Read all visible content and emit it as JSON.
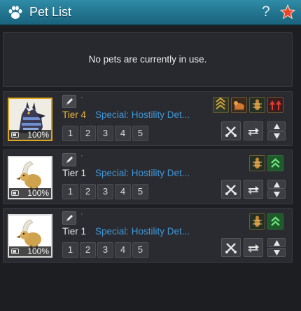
{
  "window": {
    "title": "Pet List",
    "help_label": "?",
    "title_icon": "paw-icon",
    "favorite_icon": "star-icon"
  },
  "notice": {
    "text": "No pets are currently in use."
  },
  "colors": {
    "titlebar": "#22748f",
    "tier_highlight": "#e6b43a",
    "special_link": "#3f97d8",
    "portrait_active_border": "#e0a51e"
  },
  "pets": [
    {
      "tier_label": "Tier",
      "tier_num": "4",
      "special": "Special: Hostility Det...",
      "stamina": "100%",
      "portrait": "armored-wolf",
      "buffs": [
        "tier-up-buff-icon",
        "gather-buff-icon",
        "bug-buff-icon",
        "attack-up-buff-icon"
      ],
      "skill_slots": [
        "1",
        "2",
        "3",
        "4",
        "5"
      ]
    },
    {
      "tier_label": "Tier",
      "tier_num": "1",
      "special": "Special: Hostility Det...",
      "stamina": "100%",
      "portrait": "white-hawk",
      "buffs": [
        "bug-buff-icon",
        "green-tier-up-buff-icon"
      ],
      "skill_slots": [
        "1",
        "2",
        "3",
        "4",
        "5"
      ]
    },
    {
      "tier_label": "Tier",
      "tier_num": "1",
      "special": "Special: Hostility Det...",
      "stamina": "100%",
      "portrait": "white-hawk",
      "buffs": [
        "bug-buff-icon",
        "green-tier-up-buff-icon"
      ],
      "skill_slots": [
        "1",
        "2",
        "3",
        "4",
        "5"
      ]
    }
  ]
}
